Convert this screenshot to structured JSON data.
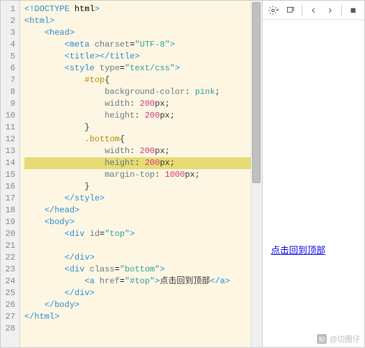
{
  "gutter": {
    "total_lines": 28,
    "fold_markers": [
      2,
      3,
      6,
      19,
      20,
      23
    ]
  },
  "code": {
    "highlighted_line": 14,
    "lines": [
      {
        "indent": 0,
        "raw": "<!DOCTYPE html>"
      },
      {
        "indent": 0,
        "raw": "<html>"
      },
      {
        "indent": 1,
        "raw": "<head>"
      },
      {
        "indent": 2,
        "raw": "<meta charset=\"UTF-8\">"
      },
      {
        "indent": 2,
        "raw": "<title></title>"
      },
      {
        "indent": 2,
        "raw": "<style type=\"text/css\">"
      },
      {
        "indent": 3,
        "sel": "#top",
        "brace": "{"
      },
      {
        "indent": 4,
        "prop": "background-color",
        "val": "pink"
      },
      {
        "indent": 4,
        "prop": "width",
        "val": "200px"
      },
      {
        "indent": 4,
        "prop": "height",
        "val": "200px"
      },
      {
        "indent": 3,
        "brace": "}"
      },
      {
        "indent": 3,
        "sel": ".bottom",
        "brace": "{"
      },
      {
        "indent": 4,
        "prop": "width",
        "val": "200px"
      },
      {
        "indent": 4,
        "prop": "height",
        "val": "200px"
      },
      {
        "indent": 4,
        "prop": "margin-top",
        "val": "1000px"
      },
      {
        "indent": 3,
        "brace": "}"
      },
      {
        "indent": 2,
        "raw": "</style>"
      },
      {
        "indent": 1,
        "raw": "</head>"
      },
      {
        "indent": 1,
        "raw": "<body>"
      },
      {
        "indent": 2,
        "raw": "<div id=\"top\">"
      },
      {
        "indent": 0,
        "raw": ""
      },
      {
        "indent": 2,
        "raw": "</div>"
      },
      {
        "indent": 2,
        "raw": "<div class=\"bottom\">"
      },
      {
        "indent": 3,
        "raw_link": {
          "open": "<a href=\"#top\">",
          "text": "点击回到顶部",
          "close": "</a>"
        }
      },
      {
        "indent": 2,
        "raw": "</div>"
      },
      {
        "indent": 1,
        "raw": "</body>"
      },
      {
        "indent": 0,
        "raw": "</html>"
      },
      {
        "indent": 0,
        "raw": ""
      }
    ]
  },
  "preview": {
    "link_text": "点击回到顶部"
  },
  "toolbar": {
    "icons": [
      "gear",
      "popout",
      "sep",
      "back",
      "forward",
      "sep",
      "stop"
    ]
  },
  "watermark": {
    "logo": "知",
    "text": "@切图仔"
  }
}
